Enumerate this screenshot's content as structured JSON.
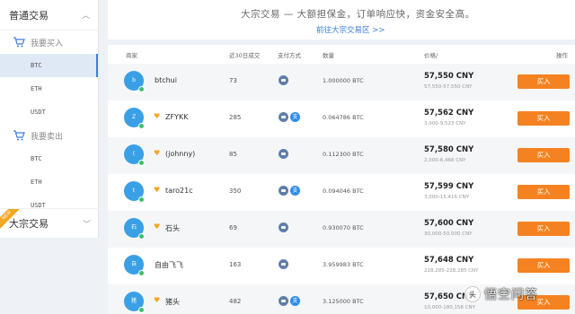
{
  "sidebar": {
    "section1_title": "普通交易",
    "buy_label": "我要买入",
    "buy_items": [
      "BTC",
      "ETH",
      "USDT"
    ],
    "sell_label": "我要卖出",
    "sell_items": [
      "BTC",
      "ETH",
      "USDT"
    ],
    "bulk_title": "大宗交易",
    "new_badge": "NEW"
  },
  "banner": {
    "text": "大宗交易 — 大额担保金，订单响应快，资金安全高。",
    "link": "前往大宗交易区 >>"
  },
  "table": {
    "headers": {
      "merchant": "商家",
      "volume": "近30日成交",
      "payment": "支付方式",
      "quantity": "数量",
      "price": "价格/",
      "action": "操作"
    },
    "rows": [
      {
        "avatar": "b",
        "name": "btchui",
        "vip": false,
        "volume": "73",
        "ali": false,
        "qty": "1.000000 BTC",
        "price": "57,550 CNY",
        "limit": "57,550-57,550 CNY",
        "buy": "买入"
      },
      {
        "avatar": "Z",
        "name": "ZFYKK",
        "vip": true,
        "volume": "285",
        "ali": true,
        "qty": "0.064786 BTC",
        "price": "57,562 CNY",
        "limit": "3,000-9,523 CNY",
        "buy": "买入"
      },
      {
        "avatar": "(",
        "name": "(johnny)",
        "vip": true,
        "volume": "85",
        "ali": false,
        "qty": "0.112300 BTC",
        "price": "57,580 CNY",
        "limit": "2,000-6,466 CNY",
        "buy": "买入"
      },
      {
        "avatar": "t",
        "name": "taro21c",
        "vip": true,
        "volume": "350",
        "ali": true,
        "qty": "0.094046 BTC",
        "price": "57,599 CNY",
        "limit": "3,000-15,416 CNY",
        "buy": "买入"
      },
      {
        "avatar": "石",
        "name": "石头",
        "vip": true,
        "volume": "69",
        "ali": false,
        "qty": "0.930070 BTC",
        "price": "57,600 CNY",
        "limit": "30,000-50,000 CNY",
        "buy": "买入"
      },
      {
        "avatar": "自",
        "name": "自由飞飞",
        "vip": false,
        "volume": "163",
        "ali": false,
        "qty": "3.959983 BTC",
        "price": "57,648 CNY",
        "limit": "228,285-228,285 CNY",
        "buy": "买入"
      },
      {
        "avatar": "猪",
        "name": "猪头",
        "vip": true,
        "volume": "482",
        "ali": true,
        "qty": "3.125000 BTC",
        "price": "57,650 CNY",
        "limit": "10,000-180,156 CNY",
        "buy": "买入"
      }
    ]
  },
  "watermark": {
    "text": "悟空问答",
    "badge": "头"
  }
}
